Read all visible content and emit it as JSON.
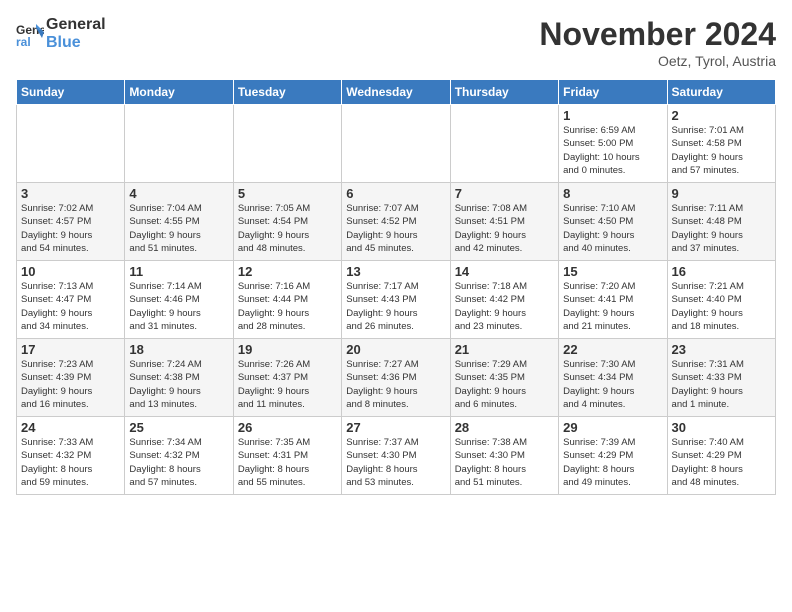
{
  "logo": {
    "line1": "General",
    "line2": "Blue"
  },
  "title": "November 2024",
  "location": "Oetz, Tyrol, Austria",
  "header_days": [
    "Sunday",
    "Monday",
    "Tuesday",
    "Wednesday",
    "Thursday",
    "Friday",
    "Saturday"
  ],
  "weeks": [
    [
      {
        "day": "",
        "detail": ""
      },
      {
        "day": "",
        "detail": ""
      },
      {
        "day": "",
        "detail": ""
      },
      {
        "day": "",
        "detail": ""
      },
      {
        "day": "",
        "detail": ""
      },
      {
        "day": "1",
        "detail": "Sunrise: 6:59 AM\nSunset: 5:00 PM\nDaylight: 10 hours\nand 0 minutes."
      },
      {
        "day": "2",
        "detail": "Sunrise: 7:01 AM\nSunset: 4:58 PM\nDaylight: 9 hours\nand 57 minutes."
      }
    ],
    [
      {
        "day": "3",
        "detail": "Sunrise: 7:02 AM\nSunset: 4:57 PM\nDaylight: 9 hours\nand 54 minutes."
      },
      {
        "day": "4",
        "detail": "Sunrise: 7:04 AM\nSunset: 4:55 PM\nDaylight: 9 hours\nand 51 minutes."
      },
      {
        "day": "5",
        "detail": "Sunrise: 7:05 AM\nSunset: 4:54 PM\nDaylight: 9 hours\nand 48 minutes."
      },
      {
        "day": "6",
        "detail": "Sunrise: 7:07 AM\nSunset: 4:52 PM\nDaylight: 9 hours\nand 45 minutes."
      },
      {
        "day": "7",
        "detail": "Sunrise: 7:08 AM\nSunset: 4:51 PM\nDaylight: 9 hours\nand 42 minutes."
      },
      {
        "day": "8",
        "detail": "Sunrise: 7:10 AM\nSunset: 4:50 PM\nDaylight: 9 hours\nand 40 minutes."
      },
      {
        "day": "9",
        "detail": "Sunrise: 7:11 AM\nSunset: 4:48 PM\nDaylight: 9 hours\nand 37 minutes."
      }
    ],
    [
      {
        "day": "10",
        "detail": "Sunrise: 7:13 AM\nSunset: 4:47 PM\nDaylight: 9 hours\nand 34 minutes."
      },
      {
        "day": "11",
        "detail": "Sunrise: 7:14 AM\nSunset: 4:46 PM\nDaylight: 9 hours\nand 31 minutes."
      },
      {
        "day": "12",
        "detail": "Sunrise: 7:16 AM\nSunset: 4:44 PM\nDaylight: 9 hours\nand 28 minutes."
      },
      {
        "day": "13",
        "detail": "Sunrise: 7:17 AM\nSunset: 4:43 PM\nDaylight: 9 hours\nand 26 minutes."
      },
      {
        "day": "14",
        "detail": "Sunrise: 7:18 AM\nSunset: 4:42 PM\nDaylight: 9 hours\nand 23 minutes."
      },
      {
        "day": "15",
        "detail": "Sunrise: 7:20 AM\nSunset: 4:41 PM\nDaylight: 9 hours\nand 21 minutes."
      },
      {
        "day": "16",
        "detail": "Sunrise: 7:21 AM\nSunset: 4:40 PM\nDaylight: 9 hours\nand 18 minutes."
      }
    ],
    [
      {
        "day": "17",
        "detail": "Sunrise: 7:23 AM\nSunset: 4:39 PM\nDaylight: 9 hours\nand 16 minutes."
      },
      {
        "day": "18",
        "detail": "Sunrise: 7:24 AM\nSunset: 4:38 PM\nDaylight: 9 hours\nand 13 minutes."
      },
      {
        "day": "19",
        "detail": "Sunrise: 7:26 AM\nSunset: 4:37 PM\nDaylight: 9 hours\nand 11 minutes."
      },
      {
        "day": "20",
        "detail": "Sunrise: 7:27 AM\nSunset: 4:36 PM\nDaylight: 9 hours\nand 8 minutes."
      },
      {
        "day": "21",
        "detail": "Sunrise: 7:29 AM\nSunset: 4:35 PM\nDaylight: 9 hours\nand 6 minutes."
      },
      {
        "day": "22",
        "detail": "Sunrise: 7:30 AM\nSunset: 4:34 PM\nDaylight: 9 hours\nand 4 minutes."
      },
      {
        "day": "23",
        "detail": "Sunrise: 7:31 AM\nSunset: 4:33 PM\nDaylight: 9 hours\nand 1 minute."
      }
    ],
    [
      {
        "day": "24",
        "detail": "Sunrise: 7:33 AM\nSunset: 4:32 PM\nDaylight: 8 hours\nand 59 minutes."
      },
      {
        "day": "25",
        "detail": "Sunrise: 7:34 AM\nSunset: 4:32 PM\nDaylight: 8 hours\nand 57 minutes."
      },
      {
        "day": "26",
        "detail": "Sunrise: 7:35 AM\nSunset: 4:31 PM\nDaylight: 8 hours\nand 55 minutes."
      },
      {
        "day": "27",
        "detail": "Sunrise: 7:37 AM\nSunset: 4:30 PM\nDaylight: 8 hours\nand 53 minutes."
      },
      {
        "day": "28",
        "detail": "Sunrise: 7:38 AM\nSunset: 4:30 PM\nDaylight: 8 hours\nand 51 minutes."
      },
      {
        "day": "29",
        "detail": "Sunrise: 7:39 AM\nSunset: 4:29 PM\nDaylight: 8 hours\nand 49 minutes."
      },
      {
        "day": "30",
        "detail": "Sunrise: 7:40 AM\nSunset: 4:29 PM\nDaylight: 8 hours\nand 48 minutes."
      }
    ]
  ]
}
